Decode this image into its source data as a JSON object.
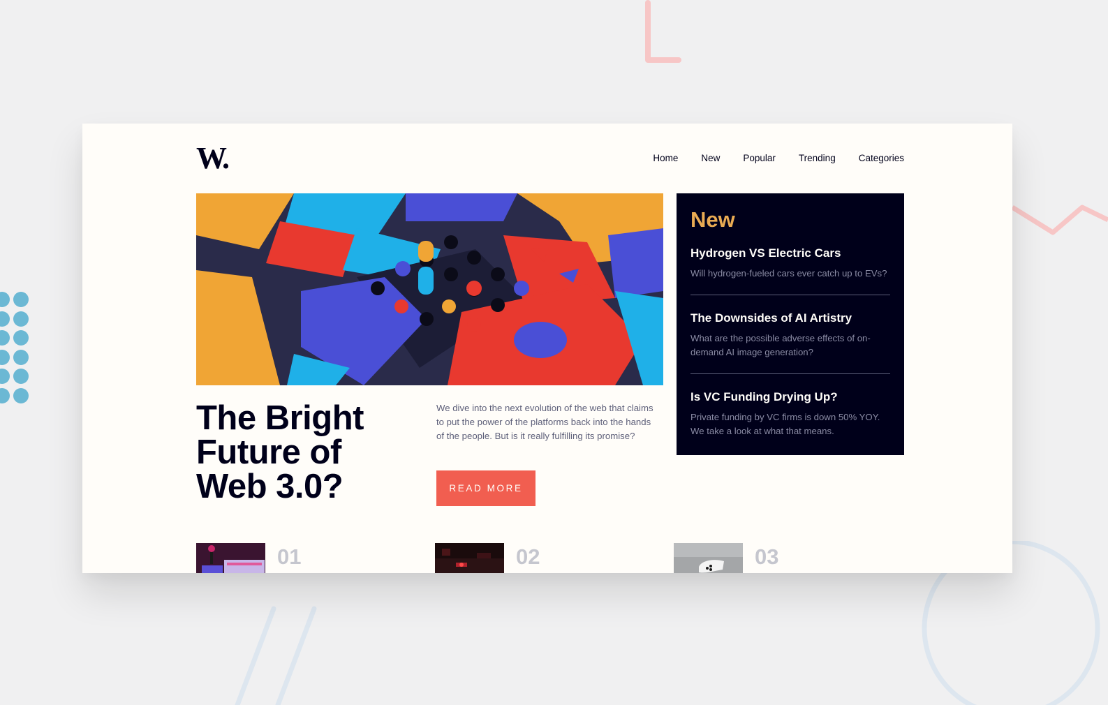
{
  "brand": {
    "logo_text": "W."
  },
  "nav": {
    "items": [
      {
        "label": "Home"
      },
      {
        "label": "New"
      },
      {
        "label": "Popular"
      },
      {
        "label": "Trending"
      },
      {
        "label": "Categories"
      }
    ]
  },
  "hero": {
    "title": "The Bright Future of Web 3.0?",
    "lede": "We dive into the next evolution of the web that claims to put the power of the platforms back into the hands of the people. But is it really fulfilling its promise?",
    "button_label": "READ MORE"
  },
  "new_panel": {
    "heading": "New",
    "items": [
      {
        "title": "Hydrogen VS Electric Cars",
        "desc": "Will hydrogen-fueled cars ever catch up to EVs?"
      },
      {
        "title": "The Downsides of AI Artistry",
        "desc": "What are the possible adverse effects of on-demand AI image generation?"
      },
      {
        "title": "Is VC Funding Drying Up?",
        "desc": "Private funding by VC firms is down 50% YOY. We take a look at what that means."
      }
    ]
  },
  "numbered": {
    "items": [
      {
        "number": "01"
      },
      {
        "number": "02"
      },
      {
        "number": "03"
      }
    ]
  },
  "colors": {
    "accent_red": "#f15e50",
    "accent_orange": "#e9ab53",
    "dark_navy": "#00001a",
    "off_white": "#fffdf9",
    "grayish_blue": "#5d5f79"
  }
}
